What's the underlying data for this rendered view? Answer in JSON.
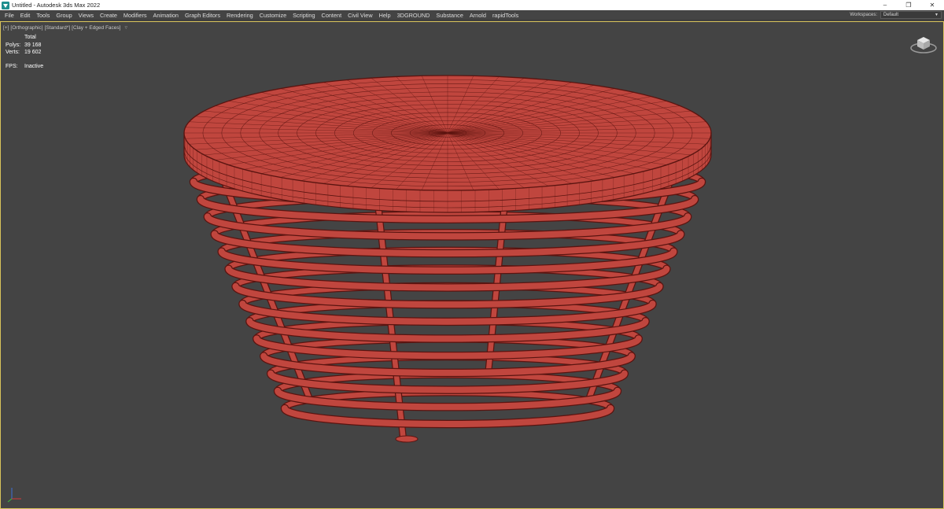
{
  "window": {
    "title": "Untitled - Autodesk 3ds Max 2022",
    "controls": [
      "minimize-icon",
      "restore-icon",
      "close-icon"
    ]
  },
  "menu": {
    "items": [
      "File",
      "Edit",
      "Tools",
      "Group",
      "Views",
      "Create",
      "Modifiers",
      "Animation",
      "Graph Editors",
      "Rendering",
      "Customize",
      "Scripting",
      "Content",
      "Civil View",
      "Help",
      "3DGROUND",
      "Substance",
      "Arnold",
      "rapidTools"
    ]
  },
  "workspace": {
    "label": "Workspaces:",
    "value": "Default"
  },
  "viewport": {
    "labels": [
      "[+]",
      "[Orthographic]",
      "[Standard*]",
      "[Clay + Edged Faces]"
    ],
    "filter_icon": "funnel-icon",
    "stats": {
      "header": "Total",
      "polys_label": "Polys:",
      "polys_value": "39 168",
      "verts_label": "Verts:",
      "verts_value": "19 602"
    },
    "fps_label": "FPS:",
    "fps_value": "Inactive",
    "colors": {
      "model": "#c0463e",
      "wire": "#5a1410",
      "background": "#444444",
      "border": "#d8c35a"
    }
  }
}
